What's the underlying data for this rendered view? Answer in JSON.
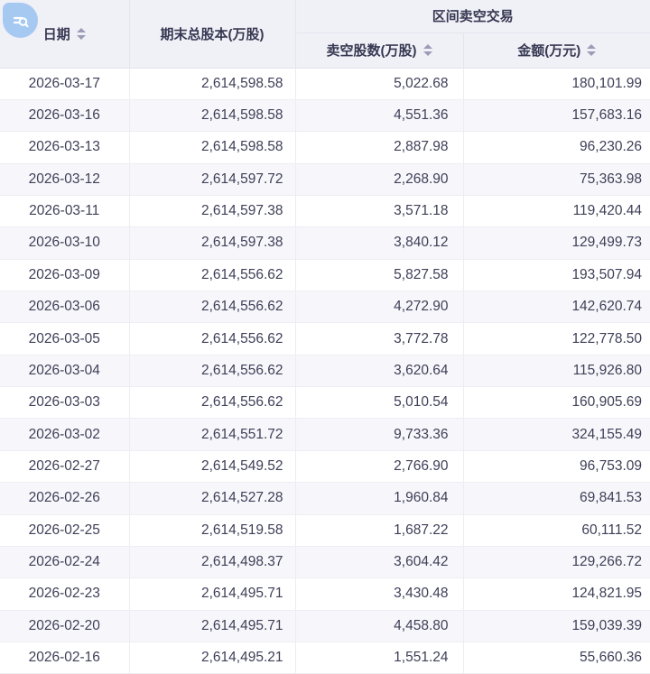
{
  "icons": {
    "corner": "search-list-icon"
  },
  "colors": {
    "corner_icon_bg": "#a6c9f2",
    "header_bg": "#f0f0f7",
    "stripe_row_bg": "#f7f7fb",
    "border": "#ececf2",
    "text": "#3e3f57",
    "header_text": "#373852",
    "sort_arrow": "#9b9cb8"
  },
  "table": {
    "headers": {
      "date": "日期",
      "total_shares": "期末总股本(万股)",
      "group": "区间卖空交易",
      "short_shares": "卖空股数(万股)",
      "amount": "金额(万元)"
    },
    "rows": [
      {
        "date": "2026-03-17",
        "total_shares": "2,614,598.58",
        "short_shares": "5,022.68",
        "amount": "180,101.99"
      },
      {
        "date": "2026-03-16",
        "total_shares": "2,614,598.58",
        "short_shares": "4,551.36",
        "amount": "157,683.16"
      },
      {
        "date": "2026-03-13",
        "total_shares": "2,614,598.58",
        "short_shares": "2,887.98",
        "amount": "96,230.26"
      },
      {
        "date": "2026-03-12",
        "total_shares": "2,614,597.72",
        "short_shares": "2,268.90",
        "amount": "75,363.98"
      },
      {
        "date": "2026-03-11",
        "total_shares": "2,614,597.38",
        "short_shares": "3,571.18",
        "amount": "119,420.44"
      },
      {
        "date": "2026-03-10",
        "total_shares": "2,614,597.38",
        "short_shares": "3,840.12",
        "amount": "129,499.73"
      },
      {
        "date": "2026-03-09",
        "total_shares": "2,614,556.62",
        "short_shares": "5,827.58",
        "amount": "193,507.94"
      },
      {
        "date": "2026-03-06",
        "total_shares": "2,614,556.62",
        "short_shares": "4,272.90",
        "amount": "142,620.74"
      },
      {
        "date": "2026-03-05",
        "total_shares": "2,614,556.62",
        "short_shares": "3,772.78",
        "amount": "122,778.50"
      },
      {
        "date": "2026-03-04",
        "total_shares": "2,614,556.62",
        "short_shares": "3,620.64",
        "amount": "115,926.80"
      },
      {
        "date": "2026-03-03",
        "total_shares": "2,614,556.62",
        "short_shares": "5,010.54",
        "amount": "160,905.69"
      },
      {
        "date": "2026-03-02",
        "total_shares": "2,614,551.72",
        "short_shares": "9,733.36",
        "amount": "324,155.49"
      },
      {
        "date": "2026-02-27",
        "total_shares": "2,614,549.52",
        "short_shares": "2,766.90",
        "amount": "96,753.09"
      },
      {
        "date": "2026-02-26",
        "total_shares": "2,614,527.28",
        "short_shares": "1,960.84",
        "amount": "69,841.53"
      },
      {
        "date": "2026-02-25",
        "total_shares": "2,614,519.58",
        "short_shares": "1,687.22",
        "amount": "60,111.52"
      },
      {
        "date": "2026-02-24",
        "total_shares": "2,614,498.37",
        "short_shares": "3,604.42",
        "amount": "129,266.72"
      },
      {
        "date": "2026-02-23",
        "total_shares": "2,614,495.71",
        "short_shares": "3,430.48",
        "amount": "124,821.95"
      },
      {
        "date": "2026-02-20",
        "total_shares": "2,614,495.71",
        "short_shares": "4,458.80",
        "amount": "159,039.39"
      },
      {
        "date": "2026-02-16",
        "total_shares": "2,614,495.21",
        "short_shares": "1,551.24",
        "amount": "55,660.36"
      }
    ]
  }
}
